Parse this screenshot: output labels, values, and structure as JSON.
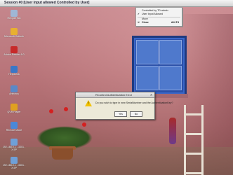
{
  "window": {
    "title": "Session #0 [User Input allowed Controlled by User]"
  },
  "desktop_icons": [
    {
      "label": "Recycle Bin",
      "icon": "recycle-bin-icon",
      "color": "#9fb7d6"
    },
    {
      "label": "Microsoft Outlook",
      "icon": "outlook-icon",
      "color": "#e8b030"
    },
    {
      "label": "Adobe Reader 6.0",
      "icon": "adobe-reader-icon",
      "color": "#c72a2a"
    },
    {
      "label": "HelpDesk",
      "icon": "helpdesk-icon",
      "color": "#3a77c8"
    },
    {
      "label": "Antivirus",
      "icon": "antivirus-icon",
      "color": "#5a88c8"
    },
    {
      "label": "QVR Player",
      "icon": "player-icon",
      "color": "#e0a020"
    },
    {
      "label": "Remote Mode",
      "icon": "remote-icon",
      "color": "#4a88d8"
    },
    {
      "label": "192.168.0.1 - 3301 - X.5P",
      "icon": "connection-icon",
      "color": "#6fa0d8"
    },
    {
      "label": "192.168.0.1 - 3301 - X.5P",
      "icon": "connection-icon",
      "color": "#6fa0d8"
    }
  ],
  "context_menu": {
    "items": [
      {
        "label": "Controlled by TD admin",
        "checked": false
      },
      {
        "label": "User Input Allowed",
        "checked": true
      },
      {
        "label": "Move",
        "checked": false
      },
      {
        "label": "Close",
        "shortcut": "Alt+F4",
        "bold": true
      }
    ]
  },
  "dialog": {
    "title": "RControl Authentication Error",
    "message": "Do you wish to type in new SerialNumber and the AuthenticationKey?",
    "yes_label": "Yes",
    "no_label": "No",
    "close_glyph": "✕",
    "warning_mark": "!"
  }
}
